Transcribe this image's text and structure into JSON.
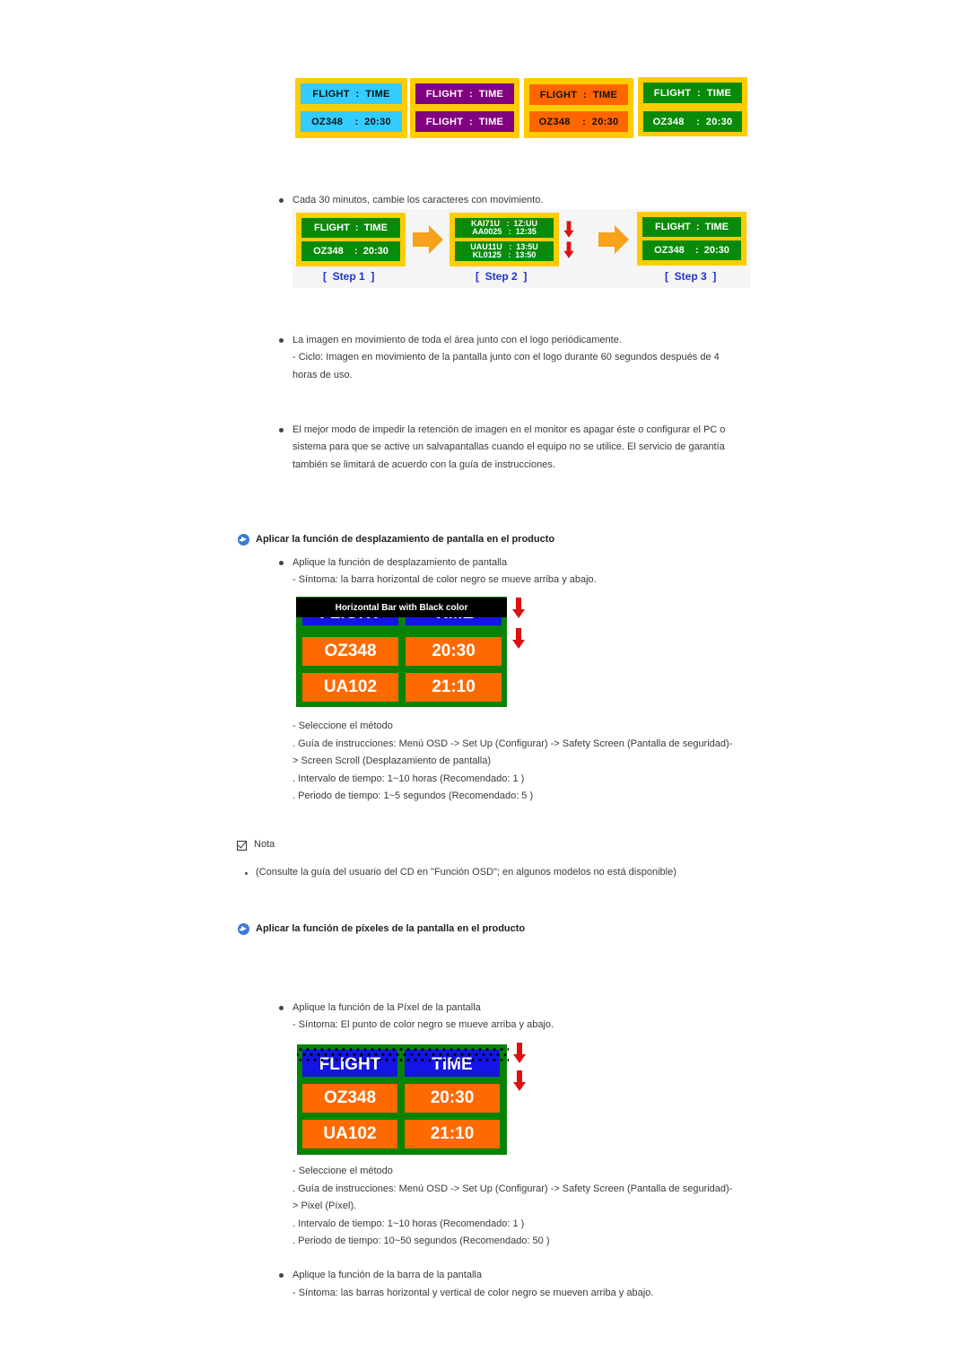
{
  "colors": {
    "panel_border": "#ffcc00",
    "cyan": "#33ccff",
    "purple": "#800080",
    "orange": "#ff6600",
    "green": "#0a8a0a",
    "board_blue": "#1414e6",
    "board_orange": "#ff6a00",
    "arrow_red": "#e01010",
    "arrow_orange": "#f7a21b",
    "step_label": "#2233cc",
    "heading_icon": "#3b7bd6"
  },
  "color_panels": [
    {
      "top": "FLIGHT  :  TIME",
      "bottom": "OZ348    :  20:30",
      "bg": "cyan",
      "fg": "#111111"
    },
    {
      "top": "FLIGHT  :  TIME",
      "bottom": "FLIGHT  :  TIME",
      "bg": "purple",
      "fg": "#ffffff"
    },
    {
      "top": "FLIGHT  :  TIME",
      "bottom": "OZ348    :  20:30",
      "bg": "orange",
      "fg": "#111111"
    },
    {
      "top": "FLIGHT  :  TIME",
      "bottom": "OZ348    :  20:30",
      "bg": "green",
      "fg": "#ffffff"
    }
  ],
  "bullet1": {
    "text": "Cada 30 minutos, cambie los caracteres con movimiento."
  },
  "steps": [
    {
      "label": "[  Step 1  ]",
      "top": "FLIGHT  :  TIME",
      "bottom": "OZ348    :  20:30"
    },
    {
      "label": "[  Step 2  ]",
      "top_lines": [
        "KAI71U   :  1Z:UU",
        "AA0025   :  12:35"
      ],
      "bottom_lines": [
        "UAU11U   :  13:5U",
        "KL0125   :  13:50"
      ]
    },
    {
      "label": "[  Step 3  ]",
      "top": "FLIGHT  :  TIME",
      "bottom": "OZ348    :  20:30"
    }
  ],
  "bullet2": {
    "text": "La imagen en movimiento de toda el área junto con el logo periódicamente.",
    "sub1": "- Ciclo: Imagen en movimiento de la pantalla junto con el logo durante 60 segundos después de 4",
    "sub2": "horas de uso."
  },
  "bullet3": {
    "line1": "El mejor modo de impedir la retención de imagen en el monitor es apagar éste o configurar el PC o",
    "line2": "sistema para que se active un salvapantallas cuando el equipo no se utilice. El servicio de garantía",
    "line3": "también se limitará de acuerdo con la guía de instrucciones."
  },
  "section1": {
    "heading": "Aplicar la función de desplazamiento de pantalla en el producto",
    "bullet": "Aplique la función de desplazamiento de pantalla",
    "symptom": "- Síntoma: la barra horizontal de color negro se mueve arriba y abajo.",
    "board": {
      "bar_label": "Horizontal Bar with Black color",
      "header": [
        "FLIGHT",
        "TIME"
      ],
      "rows": [
        [
          "OZ348",
          "20:30"
        ],
        [
          "UA102",
          "21:10"
        ]
      ]
    },
    "method_lines": [
      "- Seleccione el método",
      ". Guía de instrucciones: Menú OSD -> Set Up (Configurar) -> Safety Screen (Pantalla de seguridad)-",
      "> Screen Scroll (Desplazamiento de pantalla)",
      ". Intervalo de tiempo: 1~10 horas (Recomendado: 1 )",
      ". Periodo de tiempo: 1~5 segundos (Recomendado: 5 )"
    ]
  },
  "note": {
    "label": "Nota",
    "text": "(Consulte la guía del usuario del CD en \"Función OSD\"; en algunos modelos no está disponible)"
  },
  "section2": {
    "heading": "Aplicar la función de píxeles de la pantalla en el producto",
    "bullet": "Aplique la función de la Píxel de la pantalla",
    "symptom": "- Síntoma: El punto de color negro se mueve arriba y abajo.",
    "board": {
      "header": [
        "FLIGHT",
        "TIME"
      ],
      "rows": [
        [
          "OZ348",
          "20:30"
        ],
        [
          "UA102",
          "21:10"
        ]
      ]
    },
    "method_lines": [
      "- Seleccione el método",
      ". Guía de instrucciones: Menú OSD -> Set Up (Configurar) -> Safety Screen (Pantalla de seguridad)-",
      "> Pixel (Píxel).",
      ". Intervalo de tiempo: 1~10 horas (Recomendado: 1 )",
      ". Periodo de tiempo: 10~50 segundos (Recomendado: 50 )"
    ],
    "bullet2": "Aplique la función de la barra de la pantalla",
    "symptom2": "- Síntoma: las barras horizontal y vertical de color negro se mueven arriba y abajo."
  }
}
